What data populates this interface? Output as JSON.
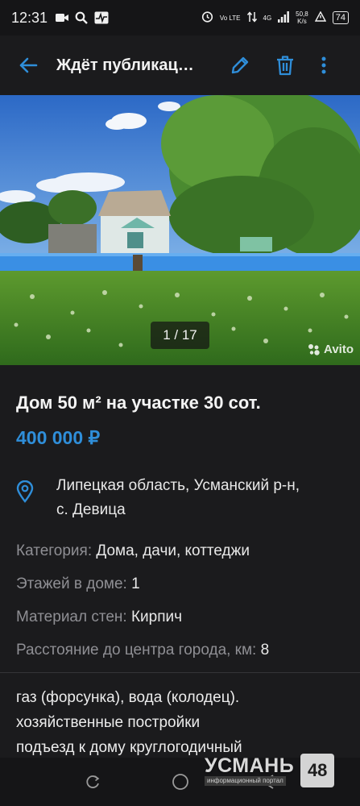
{
  "status_bar": {
    "time": "12:31",
    "net_label": "Vo LTE",
    "signal_label": "4G",
    "speed_value": "50,8",
    "speed_unit": "K/s",
    "battery": "74"
  },
  "app_bar": {
    "title": "Ждёт публикац…",
    "icons": [
      "arrow-left-icon",
      "pencil-icon",
      "trash-icon",
      "more-vertical-icon"
    ],
    "accent": "#2f8ed9"
  },
  "photo": {
    "counter": "1 / 17",
    "watermark": "Avito"
  },
  "listing": {
    "title": "Дом 50 м² на участке 30 сот.",
    "price": "400 000 ₽",
    "address_line1": "Липецкая область, Усманский р-н,",
    "address_line2": "с. Девица",
    "params": [
      {
        "label": "Категория:",
        "value": "Дома, дачи, коттеджи"
      },
      {
        "label": "Этажей в доме:",
        "value": "1"
      },
      {
        "label": "Материал стен:",
        "value": "Кирпич"
      },
      {
        "label": "Расстояние до центра города, км:",
        "value": "8"
      }
    ],
    "description_lines": [
      "газ (форсунка), вода (колодец).",
      "хозяйственные постройки",
      "подъезд к дому круглогодичный"
    ]
  },
  "portal": {
    "name": "УСМАНЬ",
    "subtitle": "информационный портал",
    "badge": "48"
  }
}
